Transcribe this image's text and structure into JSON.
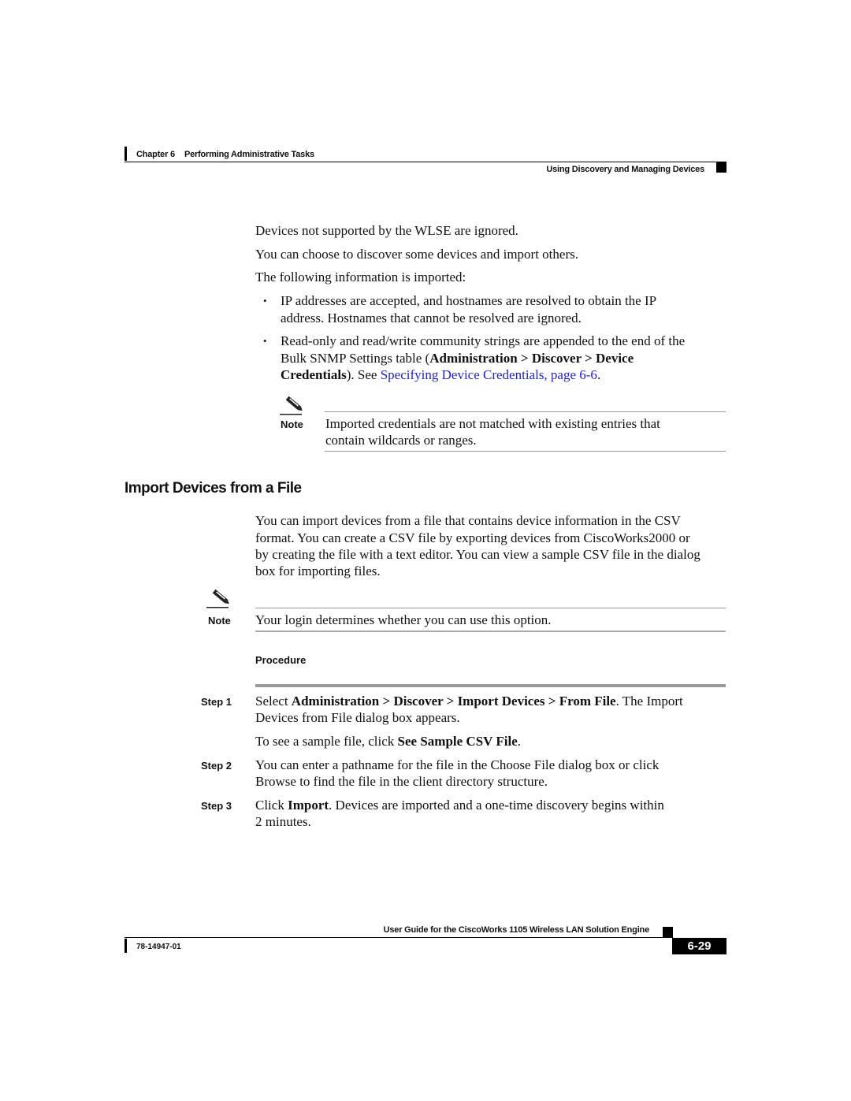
{
  "header": {
    "chapter": "Chapter 6",
    "chapter_title": "Performing Administrative Tasks",
    "section": "Using Discovery and Managing Devices"
  },
  "intro": {
    "p1": "Devices not supported by the WLSE are ignored.",
    "p2": "You can choose to discover some devices and import others.",
    "p3": "The following information is imported:",
    "bullets": [
      {
        "line1": "IP addresses are accepted, and hostnames are resolved to obtain the IP",
        "line2": "address. Hostnames that cannot be resolved are ignored."
      },
      {
        "line1": "Read-only and read/write community strings are appended to the end of the",
        "line2_prefix": "Bulk SNMP Settings table (",
        "line2_bold": "Administration > Discover > Device",
        "line3_bold": "Credentials",
        "line3_mid": "). See ",
        "line3_link": "Specifying Device Credentials, page 6-6",
        "line3_end": "."
      }
    ],
    "note": {
      "label": "Note",
      "line1": "Imported credentials are not matched with existing entries that",
      "line2": "contain wildcards or ranges."
    }
  },
  "section": {
    "title": "Import Devices from a File",
    "para": [
      "You can import devices from a file that contains device information in the CSV",
      "format. You can create a CSV file by exporting devices from CiscoWorks2000 or",
      "by creating the file with a text editor. You can view a sample CSV file in the dialog",
      "box for importing files."
    ],
    "note": {
      "label": "Note",
      "text": "Your login determines whether you can use this option."
    },
    "procedure_label": "Procedure",
    "steps": [
      {
        "label": "Step 1",
        "pre": "Select ",
        "bold": "Administration > Discover > Import Devices > From File",
        "post": ". The Import",
        "line2": "Devices from File dialog box appears.",
        "sub_pre": "To see a sample file, click ",
        "sub_bold": "See Sample CSV File",
        "sub_post": "."
      },
      {
        "label": "Step 2",
        "line1": "You can enter a pathname for the file in the Choose File dialog box or click",
        "line2": "Browse to find the file in the client directory structure."
      },
      {
        "label": "Step 3",
        "pre": "Click ",
        "bold": "Import",
        "post": ". Devices are imported and a one-time discovery begins within",
        "line2": "2 minutes."
      }
    ]
  },
  "footer": {
    "title": "User Guide for the CiscoWorks 1105 Wireless LAN Solution Engine",
    "doc_number": "78-14947-01",
    "page": "6-29"
  },
  "colors": {
    "link": "#2222cc",
    "rule": "#999999"
  }
}
